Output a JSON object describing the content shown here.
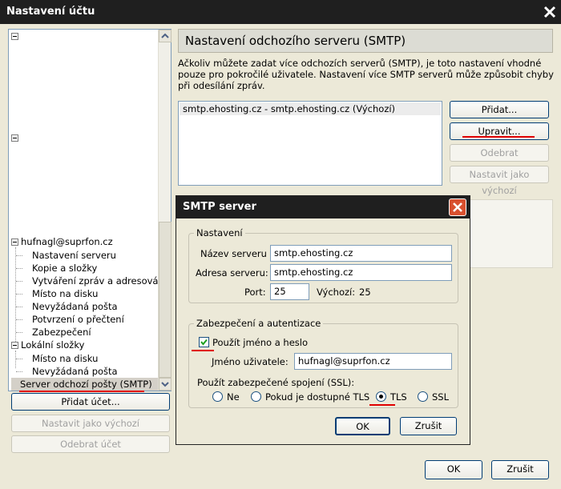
{
  "window": {
    "title": "Nastavení účtu"
  },
  "tree": {
    "account": "hufnagl@suprfon.cz",
    "account_children": [
      "Nastavení serveru",
      "Kopie a složky",
      "Vytváření zpráv a adresová...",
      "Místo na disku",
      "Nevyžádaná pošta",
      "Potvrzení o přečtení",
      "Zabezpečení"
    ],
    "local": "Lokální složky",
    "local_children": [
      "Místo na disku",
      "Nevyžádaná pošta"
    ],
    "smtp": "Server odchozí pošty (SMTP)"
  },
  "left_buttons": {
    "add_account": "Přidat účet...",
    "set_default": "Nastavit jako výchozí",
    "remove_account": "Odebrat účet"
  },
  "panel": {
    "header": "Nastavení odchozího serveru (SMTP)",
    "description": "Ačkoliv můžete zadat více odchozích serverů (SMTP), je toto nastavení vhodné pouze pro pokročilé uživatele. Nastavení více SMTP serverů může způsobit chyby při odesílání zpráv.",
    "server_entry": "smtp.ehosting.cz - smtp.ehosting.cz (Výchozí)",
    "add": "Přidat...",
    "edit": "Upravit...",
    "remove": "Odebrat",
    "set_default": "Nastavit jako výchozí"
  },
  "dialog": {
    "title": "SMTP server",
    "settings_group": "Nastavení",
    "server_name_label": "Název serveru",
    "server_name_value": "smtp.ehosting.cz",
    "server_address_label": "Adresa serveru:",
    "server_address_value": "smtp.ehosting.cz",
    "port_label": "Port:",
    "port_value": "25",
    "default_label": "Výchozí:",
    "default_value": "25",
    "security_group": "Zabezpečení a autentizace",
    "use_auth_label": "Použít jméno a heslo",
    "username_label": "Jméno uživatele:",
    "username_value": "hufnagl@suprfon.cz",
    "ssl_label": "Použít zabezpečené spojení (SSL):",
    "ssl_options": [
      "Ne",
      "Pokud je dostupné TLS",
      "TLS",
      "SSL"
    ],
    "ok": "OK",
    "cancel": "Zrušit"
  },
  "footer": {
    "ok": "OK",
    "cancel": "Zrušit"
  },
  "colors": {
    "annotation": "#e00000",
    "titlebar": "#1f1f1f"
  }
}
